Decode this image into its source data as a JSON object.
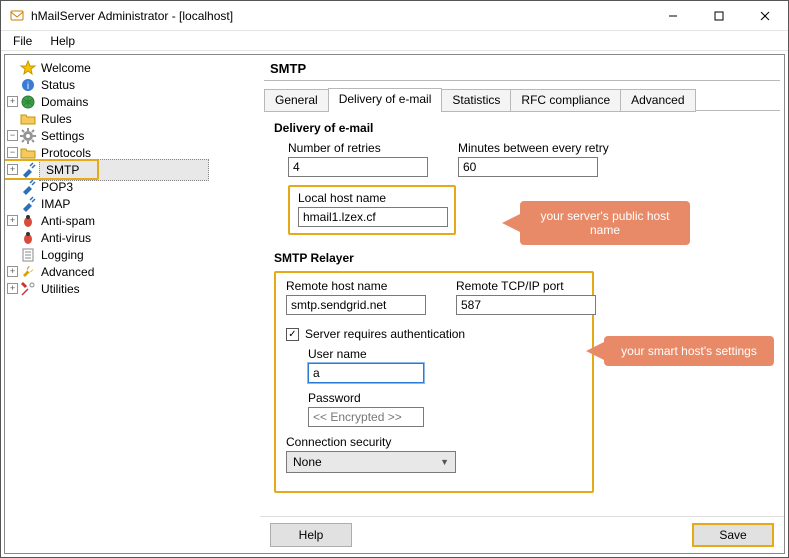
{
  "window": {
    "title": "hMailServer Administrator - [localhost]"
  },
  "menu": {
    "file": "File",
    "help": "Help"
  },
  "tree": {
    "welcome": "Welcome",
    "status": "Status",
    "domains": "Domains",
    "rules": "Rules",
    "settings": "Settings",
    "protocols": "Protocols",
    "smtp": "SMTP",
    "pop3": "POP3",
    "imap": "IMAP",
    "antispam": "Anti-spam",
    "antivirus": "Anti-virus",
    "logging": "Logging",
    "advanced": "Advanced",
    "utilities": "Utilities"
  },
  "panel": {
    "title": "SMTP",
    "tabs": {
      "general": "General",
      "delivery": "Delivery of e-mail",
      "statistics": "Statistics",
      "rfc": "RFC compliance",
      "advanced": "Advanced"
    }
  },
  "delivery": {
    "heading": "Delivery of e-mail",
    "retries_label": "Number of retries",
    "retries_value": "4",
    "minutes_label": "Minutes between every retry",
    "minutes_value": "60",
    "localhost_label": "Local host name",
    "localhost_value": "hmail1.lzex.cf"
  },
  "relayer": {
    "heading": "SMTP Relayer",
    "remotehost_label": "Remote host name",
    "remotehost_value": "smtp.sendgrid.net",
    "port_label": "Remote TCP/IP port",
    "port_value": "587",
    "auth_label": "Server requires authentication",
    "username_label": "User name",
    "username_value": "a",
    "password_label": "Password",
    "password_value": "<< Encrypted >>",
    "connsec_label": "Connection security",
    "connsec_value": "None"
  },
  "callouts": {
    "hostname": "your server's public host name",
    "smarthost": "your smart host's settings"
  },
  "footer": {
    "help": "Help",
    "save": "Save"
  }
}
